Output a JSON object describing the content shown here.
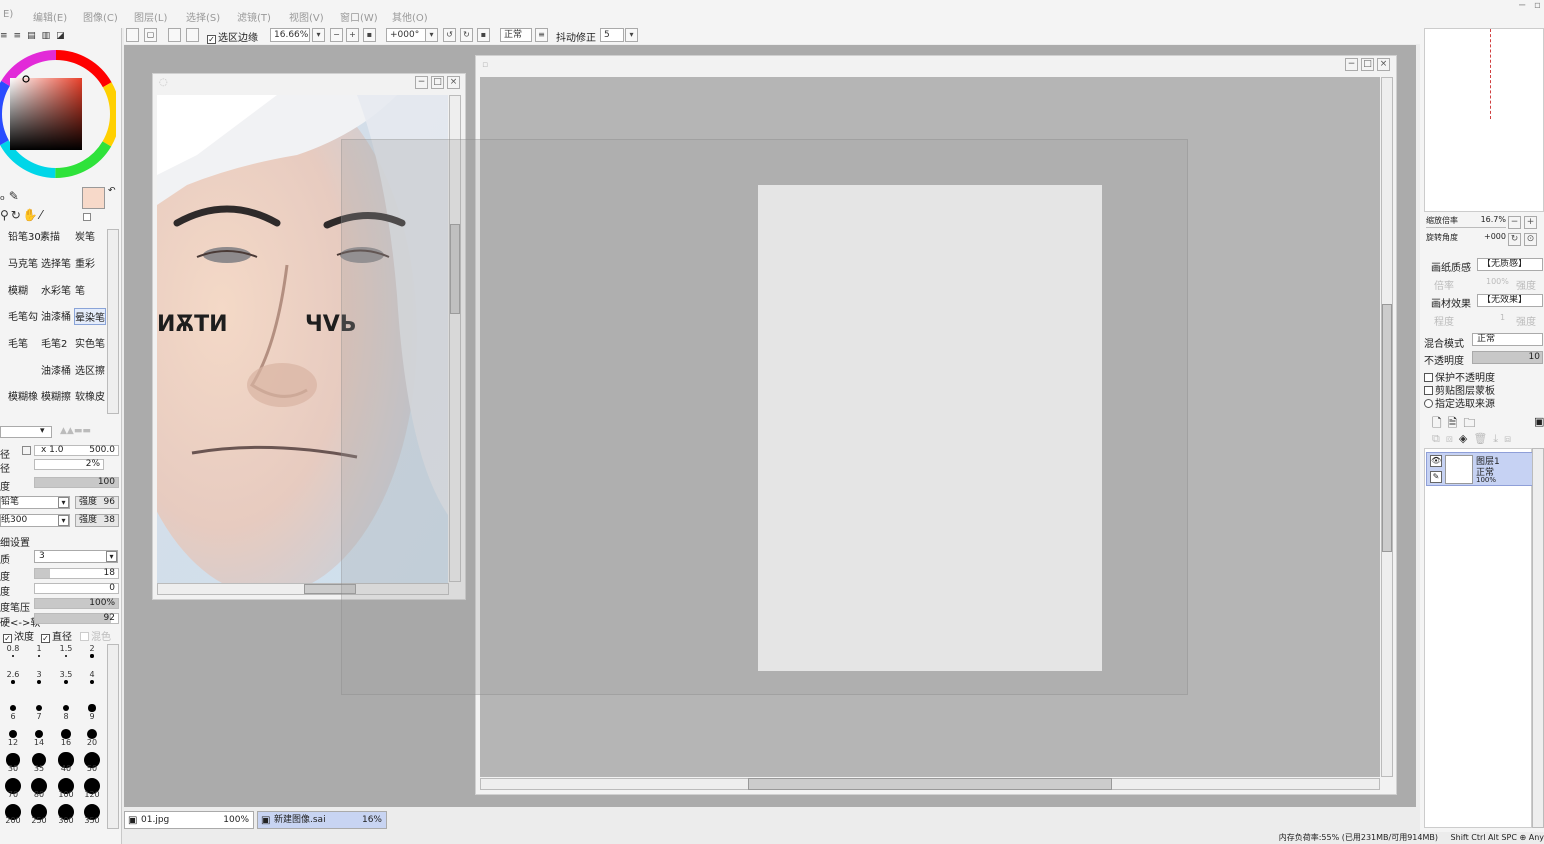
{
  "menu": {
    "items": [
      "E)",
      "编辑(E)",
      "图像(C)",
      "图层(L)",
      "选择(S)",
      "滤镜(T)",
      "视图(V)",
      "窗口(W)",
      "其他(O)"
    ]
  },
  "toolbar": {
    "selection_edge_label": "选区边缘",
    "zoom_value": "16.66%",
    "rotation_value": "+000°",
    "blend_mode": "正常",
    "stabilizer_label": "抖动修正",
    "stabilizer_value": "5"
  },
  "brushes": [
    {
      "label": "铅笔30"
    },
    {
      "label": "素描"
    },
    {
      "label": "炭笔"
    },
    {
      "label": "马克笔"
    },
    {
      "label": "选择笔"
    },
    {
      "label": "重彩"
    },
    {
      "label": "模糊"
    },
    {
      "label": "水彩笔"
    },
    {
      "label": "笔"
    },
    {
      "label": "毛笔勾"
    },
    {
      "label": "油漆桶"
    },
    {
      "label": "晕染笔"
    },
    {
      "label": "毛笔"
    },
    {
      "label": "毛笔2"
    },
    {
      "label": "实色笔"
    },
    {
      "label": "油漆桶"
    },
    {
      "label": "选区擦"
    },
    {
      "label": "模糊橡"
    },
    {
      "label": "模糊擦"
    },
    {
      "label": "软橡皮"
    }
  ],
  "brush_settings": {
    "diameter_label": "径",
    "diameter_mult": "x 1.0",
    "diameter_value": "500.0",
    "min_diameter_label": "径",
    "min_diameter_value": "2%",
    "density_label": "度",
    "density_value": "100",
    "shape1_name": "铅笔",
    "shape1_strength_label": "强度",
    "shape1_strength": "96",
    "shape2_name": "纸300",
    "shape2_strength_label": "强度",
    "shape2_strength": "38",
    "detail_label": "细设置",
    "quality_label": "质",
    "quality_value": "3",
    "edge_label": "度",
    "edge_value": "18",
    "min_density_label": "度",
    "min_density_value": "0",
    "pressure_label": "度笔压",
    "pressure_value": "100%",
    "pressure_hard_label": "硬<->软",
    "pressure_hard_value": "92",
    "check_density": "浓度",
    "check_diameter": "直径",
    "check_mix": "混色"
  },
  "brush_sizes": [
    "0.8",
    "1",
    "1.5",
    "2",
    "2.6",
    "3",
    "3.5",
    "4",
    "6",
    "7",
    "8",
    "9",
    "12",
    "14",
    "16",
    "20",
    "30",
    "35",
    "40",
    "50",
    "70",
    "80",
    "100",
    "120",
    "200",
    "250",
    "300",
    "350"
  ],
  "reference_image": {
    "face_text_left": "ИѪTИ",
    "face_text_right": "ЧVЬ"
  },
  "tabs": [
    {
      "name": "01.jpg",
      "zoom": "100%"
    },
    {
      "name": "新建图像.sai",
      "zoom": "16%"
    }
  ],
  "right_panel": {
    "zoom_label": "缩放倍率",
    "zoom_value": "16.7%",
    "rotate_label": "旋转角度",
    "rotate_value": "+000",
    "paper_texture_label": "画纸质感",
    "paper_texture_value": "【无质感】",
    "scale_label": "倍率",
    "scale_value": "100%",
    "strength_label": "强度",
    "material_label": "画材效果",
    "material_value": "【无效果】",
    "degree_label": "程度",
    "degree_value": "1",
    "strength2_label": "强度",
    "blend_label": "混合模式",
    "blend_value": "正常",
    "opacity_label": "不透明度",
    "opacity_value": "10",
    "protect_opacity": "保护不透明度",
    "clipping_group": "剪贴图层蒙板",
    "selection_source": "指定选取来源",
    "layer_name": "图层1",
    "layer_mode": "正常",
    "layer_opacity": "100%"
  },
  "status": {
    "memory": "内存负荷率:55% (已用231MB/可用914MB)",
    "keys": "Shift Ctrl Alt SPC",
    "any": "Any"
  },
  "colors": {
    "current_color": "#f7d9c9",
    "secondary_color": "#5b8ee0",
    "canvas_bg": "#b5b5b5",
    "workspace_bg": "#ababab"
  }
}
